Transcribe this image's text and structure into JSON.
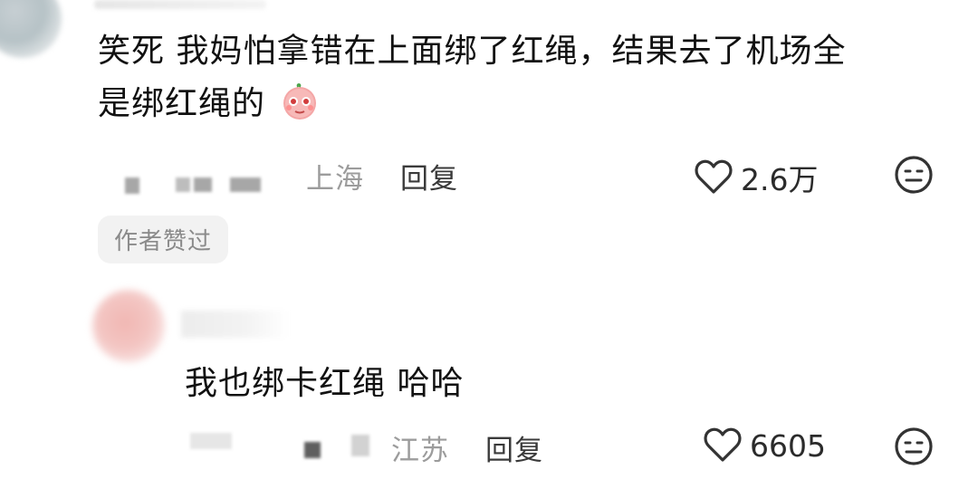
{
  "top_comment": {
    "text_line1": "笑死 我妈怕拿错在上面绑了红绳，结果去了机场全",
    "text_line2": "是绑红绳的",
    "emoji": "blush-pleading-emoji",
    "location": "上海",
    "reply_label": "回复",
    "likes": "2.6万",
    "badge": "作者赞过"
  },
  "reply_comment": {
    "text": "我也绑卡红绳 哈哈",
    "location": "江苏",
    "reply_label": "回复",
    "likes": "6605"
  },
  "icons": {
    "like": "heart-outline-icon",
    "dislike": "neutral-face-icon"
  }
}
